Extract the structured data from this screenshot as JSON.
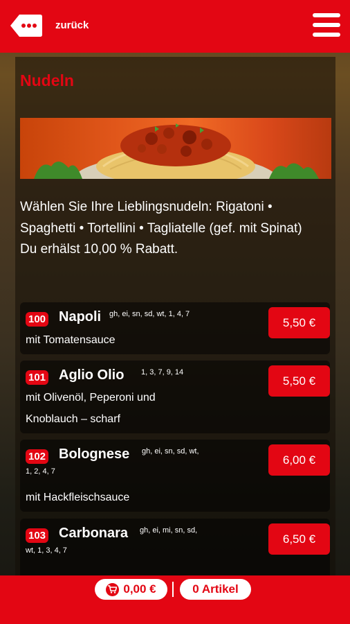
{
  "header": {
    "back_label": "zurück",
    "back_icon": "ellipsis-tag-icon",
    "menu_icon": "hamburger-icon"
  },
  "category": {
    "title": "Nudeln",
    "banner_image": "spaghetti-bolognese-photo",
    "description": "Wählen Sie Ihre Lieblingsnudeln: Rigatoni • Spaghetti • Tortellini • Tagliatelle (gef. mit Spinat)",
    "discount": "Du erhälst 10,00 % Rabatt."
  },
  "items": [
    {
      "number": "100",
      "name": "Napoli",
      "allergens": "gh, ei, sn, sd, wt, 1, 4, 7",
      "description": "mit Tomatensauce",
      "price": "5,50 €"
    },
    {
      "number": "101",
      "name": "Aglio Olio",
      "allergens": "1, 3, 7, 9, 14",
      "description": "mit Olivenöl, Peperoni und Knoblauch – scharf",
      "price": "5,50 €"
    },
    {
      "number": "102",
      "name": "Bolognese",
      "allergens_line1": "gh, ei, sn, sd, wt,",
      "allergens_line2": "1, 2, 4, 7",
      "description": "mit Hackfleischsauce",
      "price": "6,00 €"
    },
    {
      "number": "103",
      "name": "Carbonara",
      "allergens_line1": "gh, ei, mi, sn, sd,",
      "allergens_line2": "wt, 1, 3, 4, 7",
      "description": "",
      "price": "6,50 €"
    }
  ],
  "footer": {
    "cart_total": "0,00 €",
    "cart_icon": "cart-icon",
    "article_count": "0 Artikel"
  },
  "colors": {
    "brand_red": "#e30613",
    "white": "#ffffff"
  }
}
